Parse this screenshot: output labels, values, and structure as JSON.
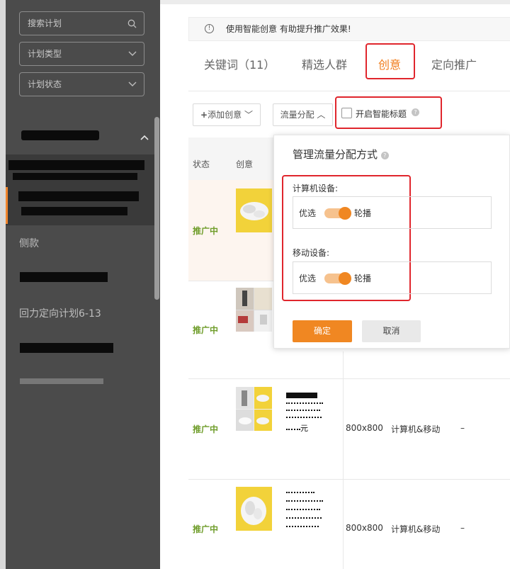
{
  "colors": {
    "accent": "#f07c1a",
    "status_green": "#6f9d2a",
    "highlight_red": "#e0262d",
    "sidebar_bg": "#4b4b4b"
  },
  "sidebar": {
    "search": {
      "placeholder": "搜索计划",
      "icon": "search-icon"
    },
    "plan_type": {
      "label": "计划类型",
      "icon": "chevron-down-icon"
    },
    "plan_status": {
      "label": "计划状态",
      "icon": "chevron-down-icon"
    },
    "items": [
      {
        "label": "侧款"
      },
      {
        "label": "回力定向计划6-13"
      }
    ]
  },
  "notice": {
    "icon": "info-icon",
    "text": "使用智能创意  有助提升推广效果!"
  },
  "tabs": [
    {
      "label": "关键词（11）"
    },
    {
      "label": "精选人群"
    },
    {
      "label": "创意"
    },
    {
      "label": "定向推广"
    }
  ],
  "toolbar": {
    "add_creative": "添加创意",
    "traffic_alloc": "流量分配",
    "smart_title": "开启智能标题"
  },
  "table": {
    "headers": {
      "status": "状态",
      "creative": "创意"
    },
    "rows": [
      {
        "status": "推广中"
      },
      {
        "status": "推广中"
      },
      {
        "status": "推广中",
        "size": "800x800",
        "device": "计算机&移动",
        "extra": "–",
        "price_suffix": "元"
      },
      {
        "status": "推广中",
        "size": "800x800",
        "device": "计算机&移动",
        "extra": "–"
      }
    ]
  },
  "popup": {
    "title": "管理流量分配方式",
    "pc_label": "计算机设备:",
    "mobile_label": "移动设备:",
    "left_option": "优选",
    "right_option": "轮播",
    "confirm": "确定",
    "cancel": "取消"
  }
}
